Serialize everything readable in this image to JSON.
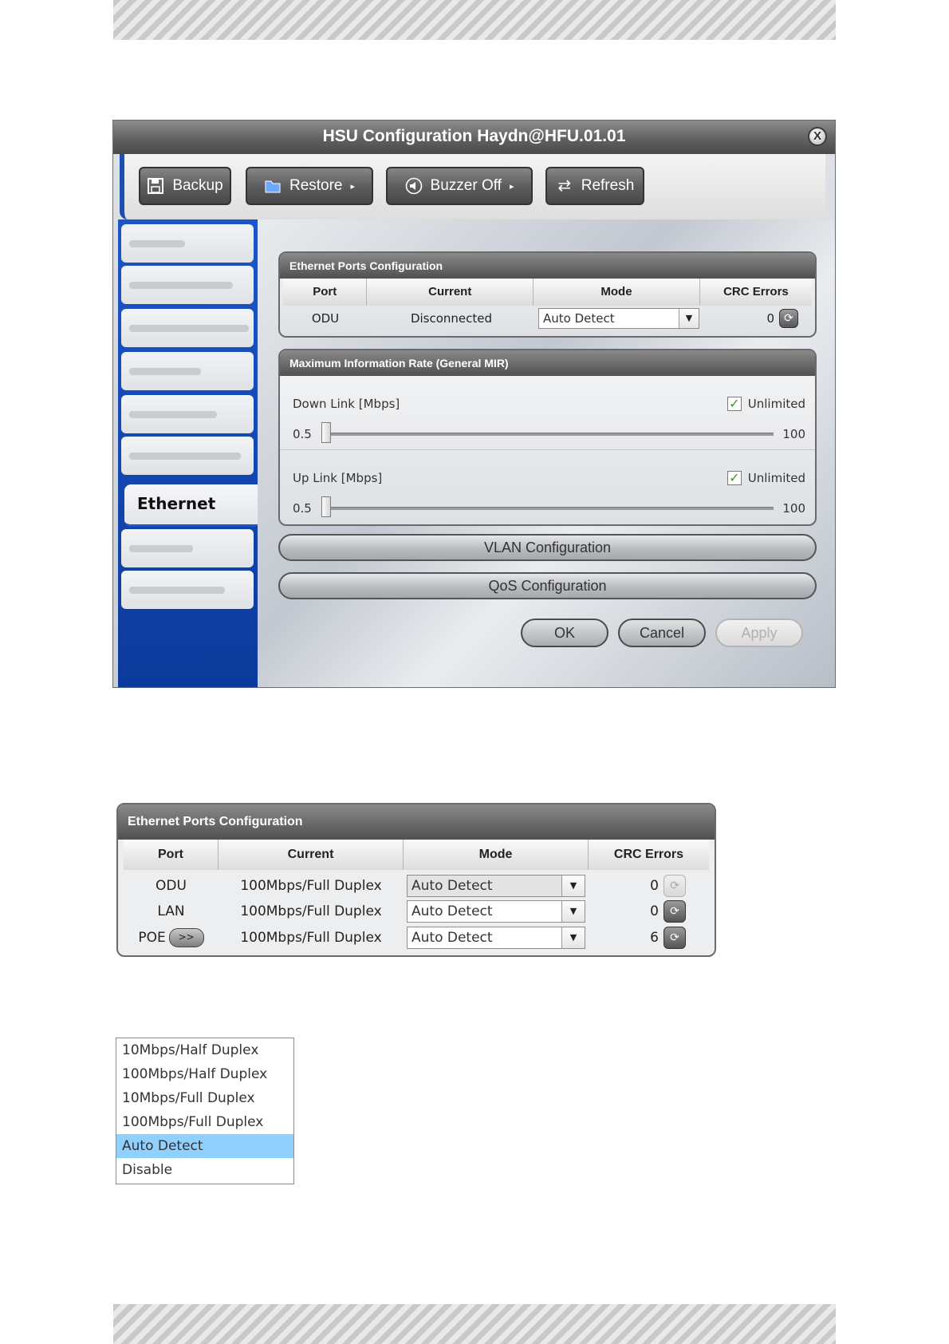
{
  "dialog": {
    "title": "HSU Configuration Haydn@HFU.01.01",
    "close_glyph": "X",
    "toolbar": {
      "backup": "Backup",
      "restore": "Restore",
      "buzzer": "Buzzer Off",
      "refresh": "Refresh"
    },
    "sidebar": {
      "active": "Ethernet"
    },
    "ports": {
      "title": "Ethernet Ports Configuration",
      "headers": [
        "Port",
        "Current",
        "Mode",
        "CRC Errors"
      ],
      "row": {
        "port": "ODU",
        "current": "Disconnected",
        "mode": "Auto Detect",
        "crc": "0"
      }
    },
    "mir": {
      "title": "Maximum Information Rate (General MIR)",
      "down": {
        "label": "Down Link [Mbps]",
        "unlimited": "Unlimited",
        "min": "0.5",
        "max": "100",
        "value_fraction": 0.0
      },
      "up": {
        "label": "Up Link [Mbps]",
        "unlimited": "Unlimited",
        "min": "0.5",
        "max": "100",
        "value_fraction": 0.0
      }
    },
    "vlan": "VLAN Configuration",
    "qos": "QoS Configuration",
    "ok": "OK",
    "cancel": "Cancel",
    "apply": "Apply"
  },
  "ports2": {
    "title": "Ethernet Ports Configuration",
    "headers": [
      "Port",
      "Current",
      "Mode",
      "CRC Errors"
    ],
    "rows": [
      {
        "port": "ODU",
        "current": "100Mbps/Full Duplex",
        "mode": "Auto Detect",
        "crc": "0"
      },
      {
        "port": "LAN",
        "current": "100Mbps/Full Duplex",
        "mode": "Auto Detect",
        "crc": "0"
      },
      {
        "port": "POE",
        "current": "100Mbps/Full Duplex",
        "mode": "Auto Detect",
        "crc": "6",
        "expand": ">>"
      }
    ]
  },
  "mode_options": [
    "10Mbps/Half Duplex",
    "100Mbps/Half Duplex",
    "10Mbps/Full Duplex",
    "100Mbps/Full Duplex",
    "Auto Detect",
    "Disable"
  ],
  "mode_selected": "Auto Detect",
  "colors": {
    "accent": "#1d55c8",
    "selection": "#8fd0ff",
    "check": "#3a9b1c"
  }
}
